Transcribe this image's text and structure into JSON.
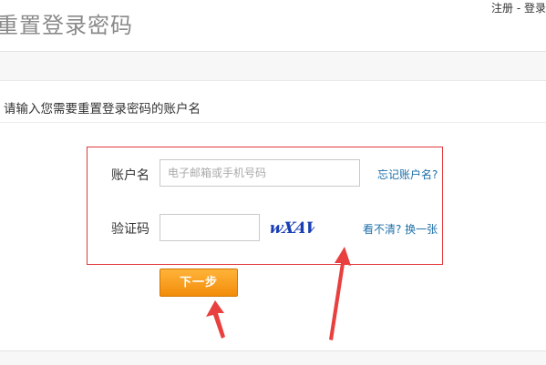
{
  "header": {
    "title": "重置登录密码",
    "register_link": "注册",
    "separator": " - ",
    "login_link": "登录"
  },
  "instruction": "请输入您需要重置登录密码的账户名",
  "form": {
    "account_label": "账户名",
    "account_placeholder": "电子邮箱或手机号码",
    "account_value": "",
    "forgot_link": "忘记账户名?",
    "captcha_label": "验证码",
    "captcha_value": "",
    "captcha_image_text": "wXAV",
    "refresh_link": "看不清? 换一张",
    "next_button": "下一步"
  },
  "colors": {
    "highlight_box": "#e0383a",
    "arrow": "#e8403e",
    "button": "#f5a11f",
    "link": "#1e6fa8"
  }
}
